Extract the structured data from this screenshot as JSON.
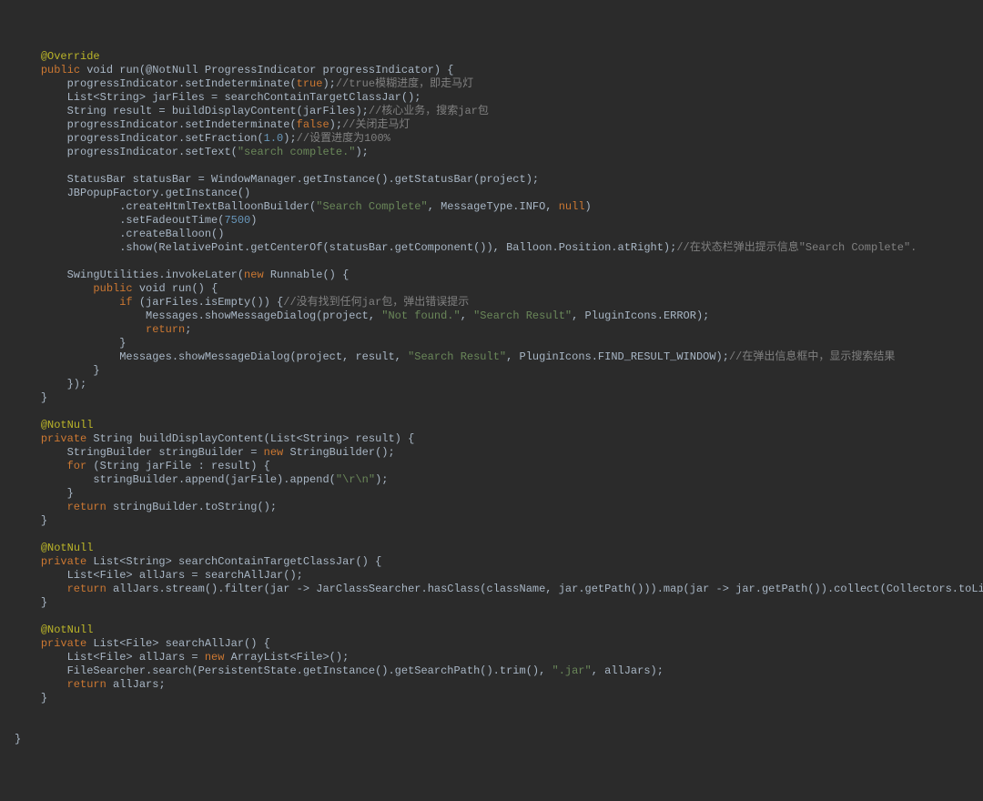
{
  "lines": [
    {
      "indent": 1,
      "segs": [
        {
          "t": "@Override",
          "c": "ann"
        }
      ]
    },
    {
      "indent": 1,
      "segs": [
        {
          "t": "public ",
          "c": "kw"
        },
        {
          "t": "void "
        },
        {
          "t": "run(@NotNull ProgressIndicator progressIndicator) {"
        }
      ]
    },
    {
      "indent": 2,
      "segs": [
        {
          "t": "progressIndicator.setIndeterminate("
        },
        {
          "t": "true",
          "c": "kw"
        },
        {
          "t": ");"
        },
        {
          "t": "//true模糊进度，即走马灯",
          "c": "cmt"
        }
      ]
    },
    {
      "indent": 2,
      "segs": [
        {
          "t": "List<String> jarFiles = searchContainTargetClassJar();"
        }
      ]
    },
    {
      "indent": 2,
      "segs": [
        {
          "t": "String result = buildDisplayContent(jarFiles);"
        },
        {
          "t": "//核心业务，搜索jar包",
          "c": "cmt"
        }
      ]
    },
    {
      "indent": 2,
      "segs": [
        {
          "t": "progressIndicator.setIndeterminate("
        },
        {
          "t": "false",
          "c": "kw"
        },
        {
          "t": ");"
        },
        {
          "t": "//关闭走马灯",
          "c": "cmt"
        }
      ]
    },
    {
      "indent": 2,
      "segs": [
        {
          "t": "progressIndicator.setFraction("
        },
        {
          "t": "1.0",
          "c": "num"
        },
        {
          "t": ");"
        },
        {
          "t": "//设置进度为100%",
          "c": "cmt"
        }
      ]
    },
    {
      "indent": 2,
      "segs": [
        {
          "t": "progressIndicator.setText("
        },
        {
          "t": "\"search complete.\"",
          "c": "str"
        },
        {
          "t": ");"
        }
      ]
    },
    {
      "indent": 0,
      "segs": [
        {
          "t": " "
        }
      ]
    },
    {
      "indent": 2,
      "segs": [
        {
          "t": "StatusBar statusBar = WindowManager.getInstance().getStatusBar(project);"
        }
      ]
    },
    {
      "indent": 2,
      "segs": [
        {
          "t": "JBPopupFactory.getInstance()"
        }
      ]
    },
    {
      "indent": 4,
      "segs": [
        {
          "t": ".createHtmlTextBalloonBuilder("
        },
        {
          "t": "\"Search Complete\"",
          "c": "str"
        },
        {
          "t": ", MessageType.INFO, "
        },
        {
          "t": "null",
          "c": "kw"
        },
        {
          "t": ")"
        }
      ]
    },
    {
      "indent": 4,
      "segs": [
        {
          "t": ".setFadeoutTime("
        },
        {
          "t": "7500",
          "c": "num"
        },
        {
          "t": ")"
        }
      ]
    },
    {
      "indent": 4,
      "segs": [
        {
          "t": ".createBalloon()"
        }
      ]
    },
    {
      "indent": 4,
      "segs": [
        {
          "t": ".show(RelativePoint.getCenterOf(statusBar.getComponent()), Balloon.Position.atRight);"
        },
        {
          "t": "//在状态栏弹出提示信息\"Search Complete\".",
          "c": "cmt"
        }
      ]
    },
    {
      "indent": 0,
      "segs": [
        {
          "t": " "
        }
      ]
    },
    {
      "indent": 2,
      "segs": [
        {
          "t": "SwingUtilities.invokeLater("
        },
        {
          "t": "new ",
          "c": "kw"
        },
        {
          "t": "Runnable() {"
        }
      ]
    },
    {
      "indent": 3,
      "segs": [
        {
          "t": "public ",
          "c": "kw"
        },
        {
          "t": "void "
        },
        {
          "t": "run() {"
        }
      ]
    },
    {
      "indent": 4,
      "segs": [
        {
          "t": "if ",
          "c": "kw"
        },
        {
          "t": "(jarFiles.isEmpty()) {"
        },
        {
          "t": "//没有找到任何jar包，弹出错误提示",
          "c": "cmt"
        }
      ]
    },
    {
      "indent": 5,
      "segs": [
        {
          "t": "Messages.showMessageDialog(project, "
        },
        {
          "t": "\"Not found.\"",
          "c": "str"
        },
        {
          "t": ", "
        },
        {
          "t": "\"Search Result\"",
          "c": "str"
        },
        {
          "t": ", PluginIcons.ERROR);"
        }
      ]
    },
    {
      "indent": 5,
      "segs": [
        {
          "t": "return",
          "c": "kw"
        },
        {
          "t": ";"
        }
      ]
    },
    {
      "indent": 4,
      "segs": [
        {
          "t": "}"
        }
      ]
    },
    {
      "indent": 4,
      "segs": [
        {
          "t": "Messages.showMessageDialog(project, result, "
        },
        {
          "t": "\"Search Result\"",
          "c": "str"
        },
        {
          "t": ", PluginIcons.FIND_RESULT_WINDOW);"
        },
        {
          "t": "//在弹出信息框中，显示搜索结果",
          "c": "cmt"
        }
      ]
    },
    {
      "indent": 3,
      "segs": [
        {
          "t": "}"
        }
      ]
    },
    {
      "indent": 2,
      "segs": [
        {
          "t": "});"
        }
      ]
    },
    {
      "indent": 1,
      "segs": [
        {
          "t": "}"
        }
      ]
    },
    {
      "indent": 0,
      "segs": [
        {
          "t": " "
        }
      ]
    },
    {
      "indent": 1,
      "segs": [
        {
          "t": "@NotNull",
          "c": "ann"
        }
      ]
    },
    {
      "indent": 1,
      "segs": [
        {
          "t": "private ",
          "c": "kw"
        },
        {
          "t": "String buildDisplayContent(List<String> result) {"
        }
      ]
    },
    {
      "indent": 2,
      "segs": [
        {
          "t": "StringBuilder stringBuilder = "
        },
        {
          "t": "new ",
          "c": "kw"
        },
        {
          "t": "StringBuilder();"
        }
      ]
    },
    {
      "indent": 2,
      "segs": [
        {
          "t": "for ",
          "c": "kw"
        },
        {
          "t": "(String jarFile : result) {"
        }
      ]
    },
    {
      "indent": 3,
      "segs": [
        {
          "t": "stringBuilder.append(jarFile).append("
        },
        {
          "t": "\"\\r\\n\"",
          "c": "str"
        },
        {
          "t": ");"
        }
      ]
    },
    {
      "indent": 2,
      "segs": [
        {
          "t": "}"
        }
      ]
    },
    {
      "indent": 2,
      "segs": [
        {
          "t": "return ",
          "c": "kw"
        },
        {
          "t": "stringBuilder.toString();"
        }
      ]
    },
    {
      "indent": 1,
      "segs": [
        {
          "t": "}"
        }
      ]
    },
    {
      "indent": 0,
      "segs": [
        {
          "t": " "
        }
      ]
    },
    {
      "indent": 1,
      "segs": [
        {
          "t": "@NotNull",
          "c": "ann"
        }
      ]
    },
    {
      "indent": 1,
      "segs": [
        {
          "t": "private ",
          "c": "kw"
        },
        {
          "t": "List<String> searchContainTargetClassJar() {"
        }
      ]
    },
    {
      "indent": 2,
      "segs": [
        {
          "t": "List<File> allJars = searchAllJar();"
        }
      ]
    },
    {
      "indent": 2,
      "segs": [
        {
          "t": "return ",
          "c": "kw"
        },
        {
          "t": "allJars.stream().filter(jar -> JarClassSearcher.hasClass(className, jar.getPath())).map(jar -> jar.getPath()).collect(Collectors.toList());"
        }
      ]
    },
    {
      "indent": 1,
      "segs": [
        {
          "t": "}"
        }
      ]
    },
    {
      "indent": 0,
      "segs": [
        {
          "t": " "
        }
      ]
    },
    {
      "indent": 1,
      "segs": [
        {
          "t": "@NotNull",
          "c": "ann"
        }
      ]
    },
    {
      "indent": 1,
      "segs": [
        {
          "t": "private ",
          "c": "kw"
        },
        {
          "t": "List<File> searchAllJar() {"
        }
      ]
    },
    {
      "indent": 2,
      "segs": [
        {
          "t": "List<File> allJars = "
        },
        {
          "t": "new ",
          "c": "kw"
        },
        {
          "t": "ArrayList<File>();"
        }
      ]
    },
    {
      "indent": 2,
      "segs": [
        {
          "t": "FileSearcher.search(PersistentState.getInstance().getSearchPath().trim(), "
        },
        {
          "t": "\".jar\"",
          "c": "str"
        },
        {
          "t": ", allJars);"
        }
      ]
    },
    {
      "indent": 2,
      "segs": [
        {
          "t": "return ",
          "c": "kw"
        },
        {
          "t": "allJars;"
        }
      ]
    },
    {
      "indent": 1,
      "segs": [
        {
          "t": "}"
        }
      ]
    },
    {
      "indent": 0,
      "segs": [
        {
          "t": " "
        }
      ]
    },
    {
      "indent": 0,
      "segs": [
        {
          "t": " "
        }
      ]
    },
    {
      "indent": 0,
      "segs": [
        {
          "t": "}"
        }
      ]
    }
  ],
  "indentUnit": "    "
}
